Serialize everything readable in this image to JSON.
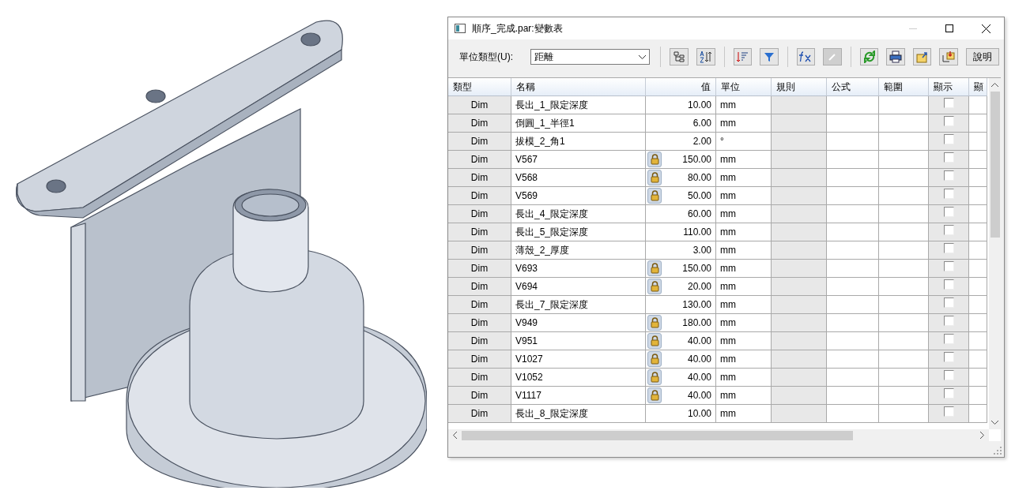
{
  "window": {
    "title": "順序_完成.par:變數表",
    "minimize_disabled": true
  },
  "toolbar": {
    "unit_label": "單位類型(U):",
    "unit_value": "距離",
    "tools": [
      {
        "kind": "tree",
        "disabled": false
      },
      {
        "kind": "sort",
        "disabled": false
      },
      {
        "kind": "order",
        "disabled": false
      },
      {
        "kind": "filter",
        "disabled": false
      },
      {
        "kind": "formula",
        "disabled": false
      },
      {
        "kind": "pencil",
        "disabled": true
      },
      {
        "kind": "refresh",
        "disabled": false
      },
      {
        "kind": "print",
        "disabled": false
      },
      {
        "kind": "export",
        "disabled": false
      },
      {
        "kind": "import",
        "disabled": false
      }
    ],
    "help": "說明"
  },
  "table": {
    "columns": [
      "類型",
      "名稱",
      "值",
      "單位",
      "規則",
      "公式",
      "範圍",
      "顯示",
      "顯"
    ],
    "rows": [
      {
        "type": "Dim",
        "name": "長出_1_限定深度",
        "locked": false,
        "value": "10.00",
        "unit": "mm",
        "shown": false
      },
      {
        "type": "Dim",
        "name": "倒圓_1_半徑1",
        "locked": false,
        "value": "6.00",
        "unit": "mm",
        "shown": false
      },
      {
        "type": "Dim",
        "name": "拔模_2_角1",
        "locked": false,
        "value": "2.00",
        "unit": "°",
        "shown": false
      },
      {
        "type": "Dim",
        "name": "V567",
        "locked": true,
        "value": "150.00",
        "unit": "mm",
        "shown": false
      },
      {
        "type": "Dim",
        "name": "V568",
        "locked": true,
        "value": "80.00",
        "unit": "mm",
        "shown": false
      },
      {
        "type": "Dim",
        "name": "V569",
        "locked": true,
        "value": "50.00",
        "unit": "mm",
        "shown": false
      },
      {
        "type": "Dim",
        "name": "長出_4_限定深度",
        "locked": false,
        "value": "60.00",
        "unit": "mm",
        "shown": false
      },
      {
        "type": "Dim",
        "name": "長出_5_限定深度",
        "locked": false,
        "value": "110.00",
        "unit": "mm",
        "shown": false
      },
      {
        "type": "Dim",
        "name": "薄殼_2_厚度",
        "locked": false,
        "value": "3.00",
        "unit": "mm",
        "shown": false
      },
      {
        "type": "Dim",
        "name": "V693",
        "locked": true,
        "value": "150.00",
        "unit": "mm",
        "shown": false
      },
      {
        "type": "Dim",
        "name": "V694",
        "locked": true,
        "value": "20.00",
        "unit": "mm",
        "shown": false
      },
      {
        "type": "Dim",
        "name": "長出_7_限定深度",
        "locked": false,
        "value": "130.00",
        "unit": "mm",
        "shown": false
      },
      {
        "type": "Dim",
        "name": "V949",
        "locked": true,
        "value": "180.00",
        "unit": "mm",
        "shown": false
      },
      {
        "type": "Dim",
        "name": "V951",
        "locked": true,
        "value": "40.00",
        "unit": "mm",
        "shown": false
      },
      {
        "type": "Dim",
        "name": "V1027",
        "locked": true,
        "value": "40.00",
        "unit": "mm",
        "shown": false
      },
      {
        "type": "Dim",
        "name": "V1052",
        "locked": true,
        "value": "40.00",
        "unit": "mm",
        "shown": false
      },
      {
        "type": "Dim",
        "name": "V1117",
        "locked": true,
        "value": "40.00",
        "unit": "mm",
        "shown": false
      },
      {
        "type": "Dim",
        "name": "長出_8_限定深度",
        "locked": false,
        "value": "10.00",
        "unit": "mm",
        "shown": false
      }
    ]
  }
}
